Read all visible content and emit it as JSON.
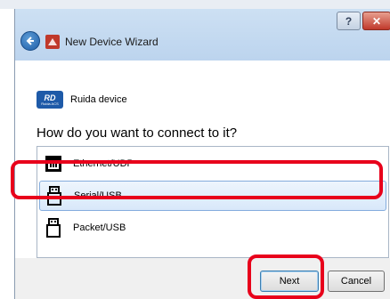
{
  "window": {
    "title": "New Device Wizard",
    "help_glyph": "?",
    "close_glyph": "✕"
  },
  "device": {
    "name": "Ruida device",
    "logo_text": "RD",
    "logo_subtext": "Ruida ACS"
  },
  "question": "How do you want to connect to it?",
  "connections": [
    {
      "label": "Ethernet/UDP",
      "icon": "ethernet-icon",
      "selected": false
    },
    {
      "label": "Serial/USB",
      "icon": "usb-icon",
      "selected": true
    },
    {
      "label": "Packet/USB",
      "icon": "usb-icon",
      "selected": false
    }
  ],
  "buttons": {
    "next": "Next",
    "cancel": "Cancel"
  },
  "colors": {
    "highlight": "#e8001b",
    "selection": "#d8e8fa",
    "brand": "#1e5aa8"
  }
}
